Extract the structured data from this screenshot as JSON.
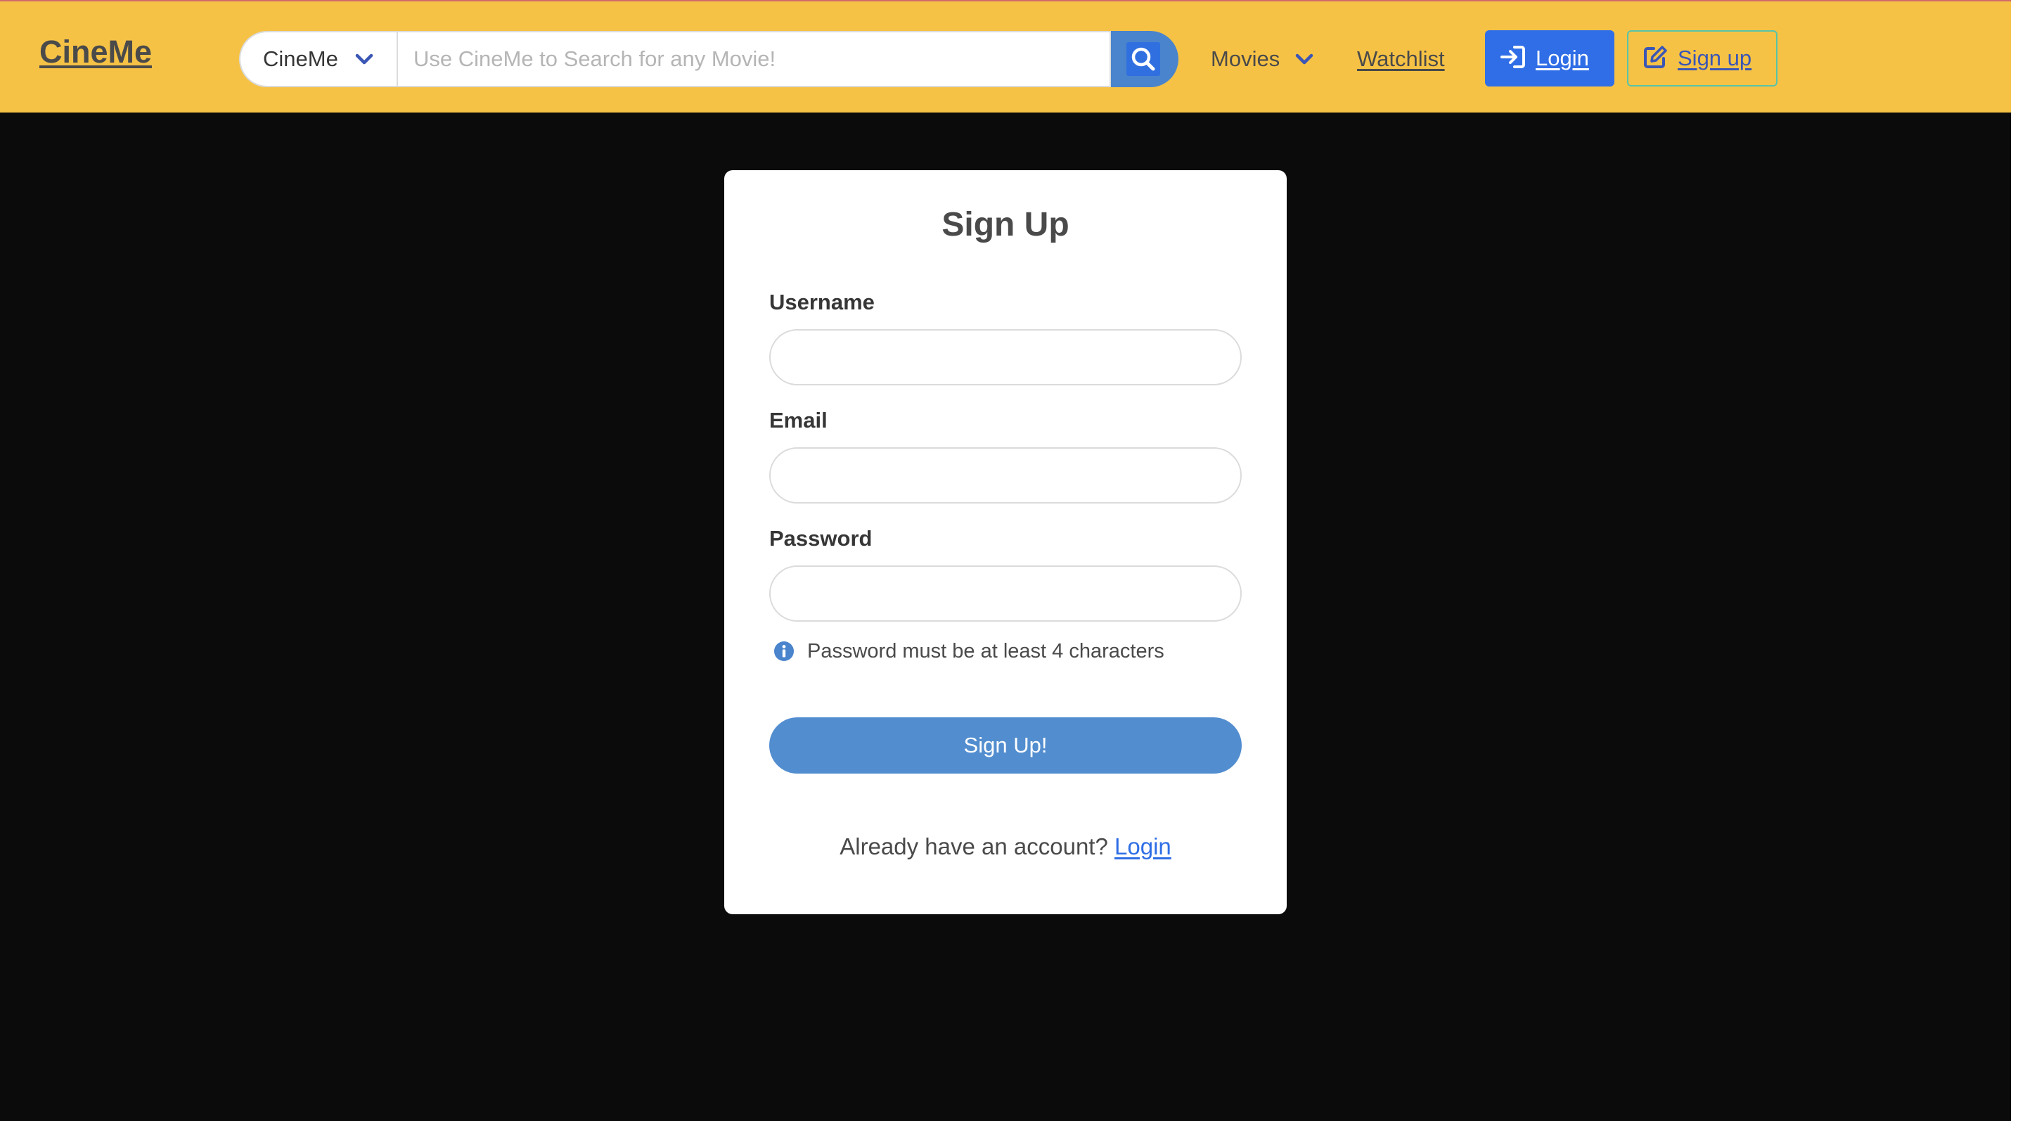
{
  "navbar": {
    "brand": "CineMe",
    "search": {
      "scope_value": "CineMe",
      "placeholder": "Use CineMe to Search for any Movie!",
      "value": ""
    },
    "movies_label": "Movies",
    "watchlist_label": "Watchlist",
    "login_label": "Login",
    "signup_label": "Sign up"
  },
  "form": {
    "title": "Sign Up",
    "username_label": "Username",
    "email_label": "Email",
    "password_label": "Password",
    "password_help": "Password must be at least 4 characters",
    "submit_label": "Sign Up!",
    "footer_text": "Already have an account?",
    "footer_link": "Login"
  },
  "icons": {
    "scope_chevron": "chevron-down-icon",
    "search": "search-icon",
    "movies_chevron": "chevron-down-icon",
    "login": "sign-in-icon",
    "signup": "edit-icon",
    "help": "info-icon"
  },
  "colors": {
    "navbar_bg": "#f6c246",
    "page_bg": "#0b0b0b",
    "primary": "#2f6ee6",
    "submit": "#528dcf",
    "signup_border": "#58c4a8",
    "chevron": "#3b56b5"
  }
}
